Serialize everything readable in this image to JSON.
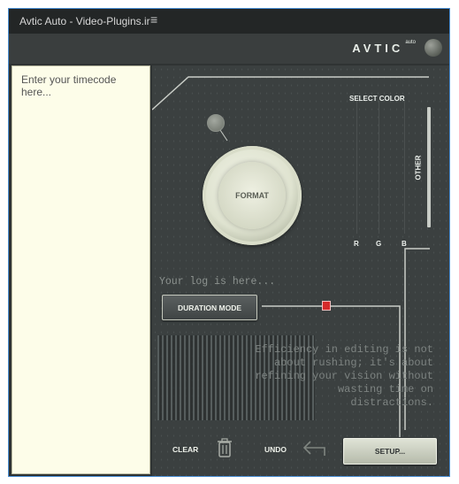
{
  "window": {
    "title": "Avtic Auto - Video-Plugins.ir",
    "menu_glyph": "≡"
  },
  "header": {
    "brand": "AVTIC",
    "brand_suffix": "auto"
  },
  "timecode": {
    "placeholder": "Enter your timecode here..."
  },
  "panel": {
    "select_color_label": "SELECT COLOR",
    "color_channels": [
      "R",
      "G",
      "B"
    ],
    "other_label": "OTHER",
    "format_label": "FORMAT",
    "log_placeholder": "Your log is here...",
    "duration_mode_label": "DURATION MODE",
    "quote_lines": [
      "Efficiency in editing is not",
      "about rushing; it's about",
      "refining your vision without",
      "wasting time on",
      "distractions."
    ],
    "clear_label": "CLEAR",
    "undo_label": "UNDO",
    "setup_label": "SETUP..."
  },
  "colors": {
    "accent_marker": "#d42a2a",
    "panel_bg": "#3b4040",
    "timecode_bg": "#fdfde9"
  },
  "icons": {
    "trash": "trash-icon",
    "undo": "undo-arrow-icon",
    "menu": "hamburger-icon"
  }
}
